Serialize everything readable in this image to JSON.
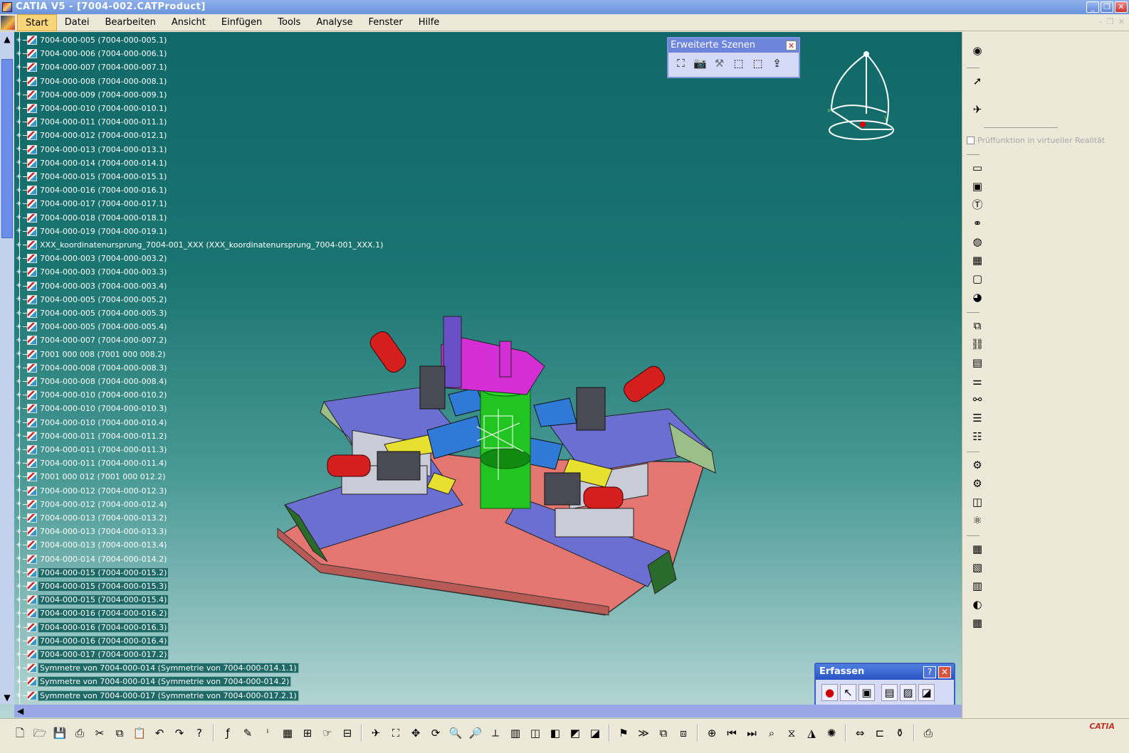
{
  "window": {
    "title": "CATIA V5 - [7004-002.CATProduct]"
  },
  "menu": [
    "Start",
    "Datei",
    "Bearbeiten",
    "Ansicht",
    "Einfügen",
    "Tools",
    "Analyse",
    "Fenster",
    "Hilfe"
  ],
  "tree": [
    "7004-000-005 (7004-000-005.1)",
    "7004-000-006 (7004-000-006.1)",
    "7004-000-007 (7004-000-007.1)",
    "7004-000-008 (7004-000-008.1)",
    "7004-000-009 (7004-000-009.1)",
    "7004-000-010 (7004-000-010.1)",
    "7004-000-011 (7004-000-011.1)",
    "7004-000-012 (7004-000-012.1)",
    "7004-000-013 (7004-000-013.1)",
    "7004-000-014 (7004-000-014.1)",
    "7004-000-015 (7004-000-015.1)",
    "7004-000-016 (7004-000-016.1)",
    "7004-000-017 (7004-000-017.1)",
    "7004-000-018 (7004-000-018.1)",
    "7004-000-019 (7004-000-019.1)",
    "XXX_koordinatenursprung_7004-001_XXX (XXX_koordinatenursprung_7004-001_XXX.1)",
    "7004-000-003 (7004-000-003.2)",
    "7004-000-003 (7004-000-003.3)",
    "7004-000-003 (7004-000-003.4)",
    "7004-000-005 (7004-000-005.2)",
    "7004-000-005 (7004-000-005.3)",
    "7004-000-005 (7004-000-005.4)",
    "7004-000-007 (7004-000-007.2)",
    "7001 000 008 (7001 000 008.2)",
    "7004-000-008 (7004-000-008.3)",
    "7004-000-008 (7004-000-008.4)",
    "7004-000-010 (7004-000-010.2)",
    "7004-000-010 (7004-000-010.3)",
    "7004-000-010 (7004-000-010.4)",
    "7004-000-011 (7004-000-011.2)",
    "7004-000-011 (7004-000-011.3)",
    "7004-000-011 (7004-000-011.4)",
    "7001 000 012 (7001 000 012.2)",
    "7004-000-012 (7004-000-012.3)",
    "7004-000-012 (7004-000-012.4)",
    "7004-000-013 (7004-000-013.2)",
    "7004-000-013 (7004-000-013.3)",
    "7004-000-013 (7004-000-013.4)",
    "7004-000-014 (7004-000-014.2)",
    "7004-000-015 (7004-000-015.2)",
    "7004-000-015 (7004-000-015.3)",
    "7004-000-015 (7004-000-015.4)",
    "7004-000-016 (7004-000-016.2)",
    "7004-000-016 (7004-000-016.3)",
    "7004-000-016 (7004-000-016.4)",
    "7004-000-017 (7004-000-017.2)",
    "Symmetre von 7004-000-014 (Symmetrie von 7004-000-014.1.1)",
    "Symmetre von 7004-000-014 (Symmetrie von 7004-000-014.2)",
    "Symmetre von 7004-000-017 (Symmetrie von 7004-000-017.2.1)"
  ],
  "selected_from": 39,
  "scenes_palette": {
    "title": "Erweiterte Szenen"
  },
  "erfassen_palette": {
    "title": "Erfassen",
    "help": "?"
  },
  "vr_checkbox": {
    "label": "Prüffunktion in virtueller Realität"
  },
  "brand": "CATIA",
  "colors": {
    "viewport_top": "#106868",
    "viewport_bottom": "#b7d7d5",
    "accent": "#6d85db"
  }
}
